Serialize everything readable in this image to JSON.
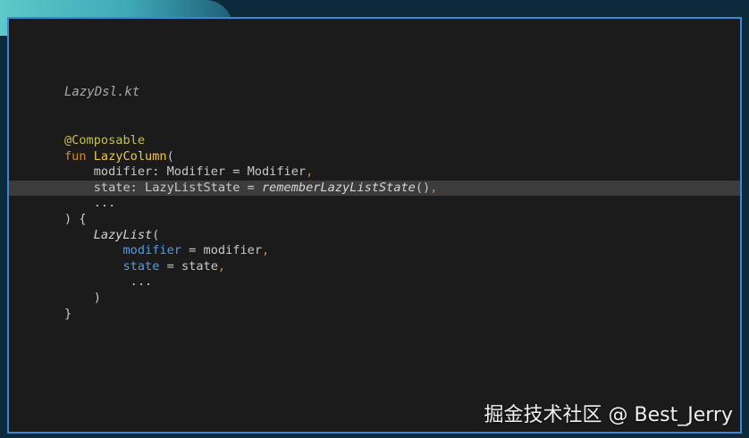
{
  "editor": {
    "filename": "LazyDsl.kt",
    "lines": [
      {
        "annotation": "@Composable"
      },
      {
        "kw": "fun",
        "fname": "LazyColumn",
        "open": "("
      },
      {
        "indent": "    ",
        "name": "modifier",
        "type": ": Modifier = Modifier",
        "comma": ","
      },
      {
        "indent": "    ",
        "name": "state",
        "type": ": LazyListState = ",
        "call": "rememberLazyListState",
        "parens": "()",
        "comma": ","
      },
      {
        "indent": "    ",
        "ellipsis": "..."
      },
      {
        "close": ") {"
      },
      {
        "indent": "    ",
        "call": "LazyList",
        "open": "("
      },
      {
        "indent": "        ",
        "param": "modifier",
        "eq": " = ",
        "value": "modifier",
        "comma": ","
      },
      {
        "indent": "        ",
        "param": "state",
        "eq": " = ",
        "value": "state",
        "comma": ","
      },
      {
        "indent": "         ",
        "ellipsis": "..."
      },
      {
        "indent": "    ",
        "close": ")"
      },
      {
        "close": "}"
      }
    ]
  },
  "watermark": "掘金技术社区 @ Best_Jerry",
  "colors": {
    "background": "#1b1b1b",
    "highlight_line": "#3c3c3c",
    "frame_border": "#3a86d8",
    "annotation": "#c8c14a",
    "keyword": "#cc8a3c",
    "function": "#f1c64a",
    "parameter": "#4f9ce6"
  }
}
